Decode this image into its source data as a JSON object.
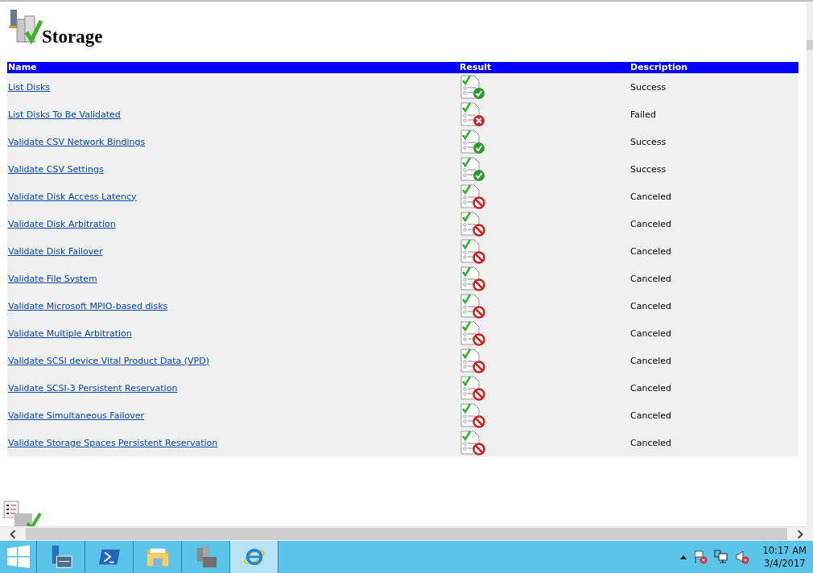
{
  "section": {
    "title": "Storage"
  },
  "table": {
    "columns": [
      "Name",
      "Result",
      "Description"
    ],
    "rows": [
      {
        "name": "List Disks",
        "kind": "success",
        "description": "Success"
      },
      {
        "name": "List Disks To Be Validated",
        "kind": "failed",
        "description": "Failed"
      },
      {
        "name": "Validate CSV Network Bindings",
        "kind": "success",
        "description": "Success"
      },
      {
        "name": "Validate CSV Settings",
        "kind": "success",
        "description": "Success"
      },
      {
        "name": "Validate Disk Access Latency",
        "kind": "canceled",
        "description": "Canceled"
      },
      {
        "name": "Validate Disk Arbitration",
        "kind": "canceled",
        "description": "Canceled"
      },
      {
        "name": "Validate Disk Failover",
        "kind": "canceled",
        "description": "Canceled"
      },
      {
        "name": "Validate File System",
        "kind": "canceled",
        "description": "Canceled"
      },
      {
        "name": "Validate Microsoft MPIO-based disks",
        "kind": "canceled",
        "description": "Canceled"
      },
      {
        "name": "Validate Multiple Arbitration",
        "kind": "canceled",
        "description": "Canceled"
      },
      {
        "name": "Validate SCSI device Vital Product Data (VPD)",
        "kind": "canceled",
        "description": "Canceled"
      },
      {
        "name": "Validate SCSI-3 Persistent Reservation",
        "kind": "canceled",
        "description": "Canceled"
      },
      {
        "name": "Validate Simultaneous Failover",
        "kind": "canceled",
        "description": "Canceled"
      },
      {
        "name": "Validate Storage Spaces Persistent Reservation",
        "kind": "canceled",
        "description": "Canceled"
      }
    ]
  },
  "taskbar": {
    "apps": [
      {
        "kind": "server-manager",
        "selected": false
      },
      {
        "kind": "powershell",
        "selected": false
      },
      {
        "kind": "explorer",
        "selected": false
      },
      {
        "kind": "tools",
        "selected": false
      },
      {
        "kind": "browser",
        "selected": true
      }
    ],
    "time": "10:17 AM",
    "date": "3/4/2017"
  }
}
